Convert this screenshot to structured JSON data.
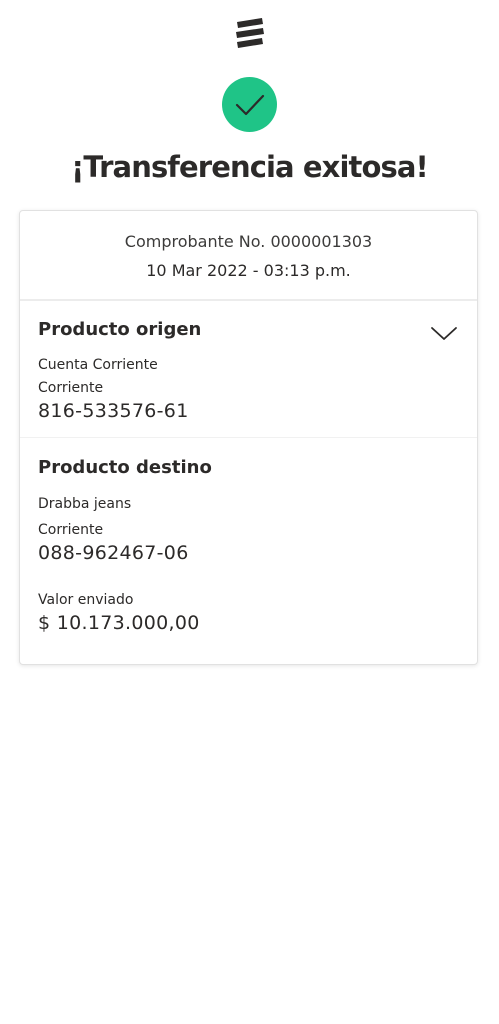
{
  "header": {
    "logo": "bank-logo",
    "success_icon": "check-icon",
    "success_color": "#1fc487",
    "title": "¡Transferencia exitosa!"
  },
  "receipt": {
    "number": "Comprobante No. 0000001303",
    "datetime": "10 Mar 2022 - 03:13 p.m."
  },
  "origin": {
    "title": "Producto origen",
    "account_name": "Cuenta Corriente",
    "account_type": "Corriente",
    "account_number": "816-533576-61",
    "expand_icon": "chevron-down-icon"
  },
  "destination": {
    "title": "Producto destino",
    "account_name": "Drabba jeans",
    "account_type": "Corriente",
    "account_number": "088-962467-06"
  },
  "amount": {
    "label": "Valor enviado",
    "value": "$ 10.173.000,00"
  }
}
